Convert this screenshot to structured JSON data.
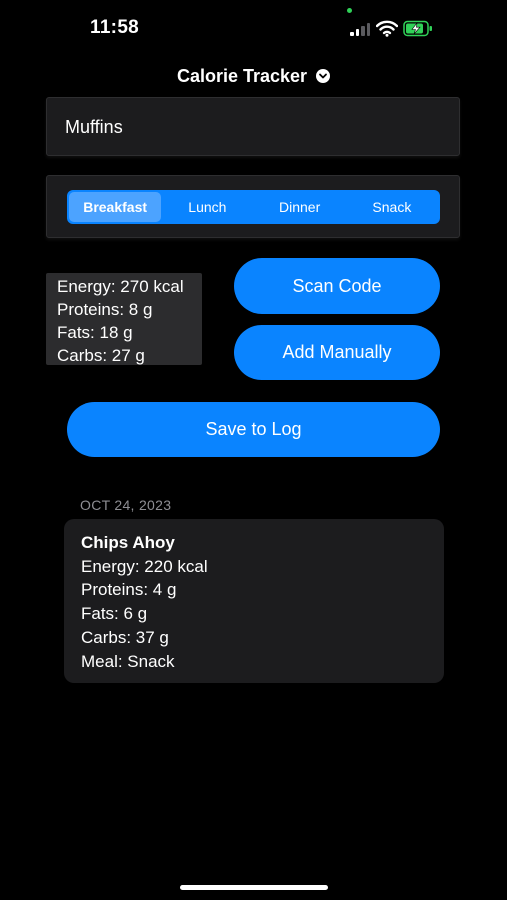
{
  "status_bar": {
    "time": "11:58",
    "icons": [
      "cellular-signal-icon",
      "wifi-icon",
      "battery-charging-icon"
    ]
  },
  "header": {
    "title": "Calorie Tracker",
    "chevron_icon": "chevron-down-circle-icon"
  },
  "food_input": {
    "value": "Muffins",
    "placeholder": ""
  },
  "meal_picker": {
    "options": [
      "Breakfast",
      "Lunch",
      "Dinner",
      "Snack"
    ],
    "selected": "Breakfast"
  },
  "nutrition": {
    "energy": "Energy: 270 kcal",
    "proteins": "Proteins: 8 g",
    "fats": "Fats: 18 g",
    "carbs": "Carbs: 27 g"
  },
  "actions": {
    "scan_label": "Scan Code",
    "manual_label": "Add Manually",
    "save_label": "Save to Log"
  },
  "log": {
    "sections": [
      {
        "date": "OCT 24, 2023",
        "entries": [
          {
            "name": "Chips Ahoy",
            "energy": "Energy: 220 kcal",
            "proteins": "Proteins: 4 g",
            "fats": "Fats: 6 g",
            "carbs": "Carbs: 37 g",
            "meal": "Meal: Snack"
          }
        ]
      }
    ]
  },
  "colors": {
    "background": "#000000",
    "accent": "#0a84ff",
    "card": "#1c1c1e",
    "nutrition_panel": "#2c2c2e",
    "secondary_text": "#8e8e93",
    "battery_green": "#30d158"
  }
}
